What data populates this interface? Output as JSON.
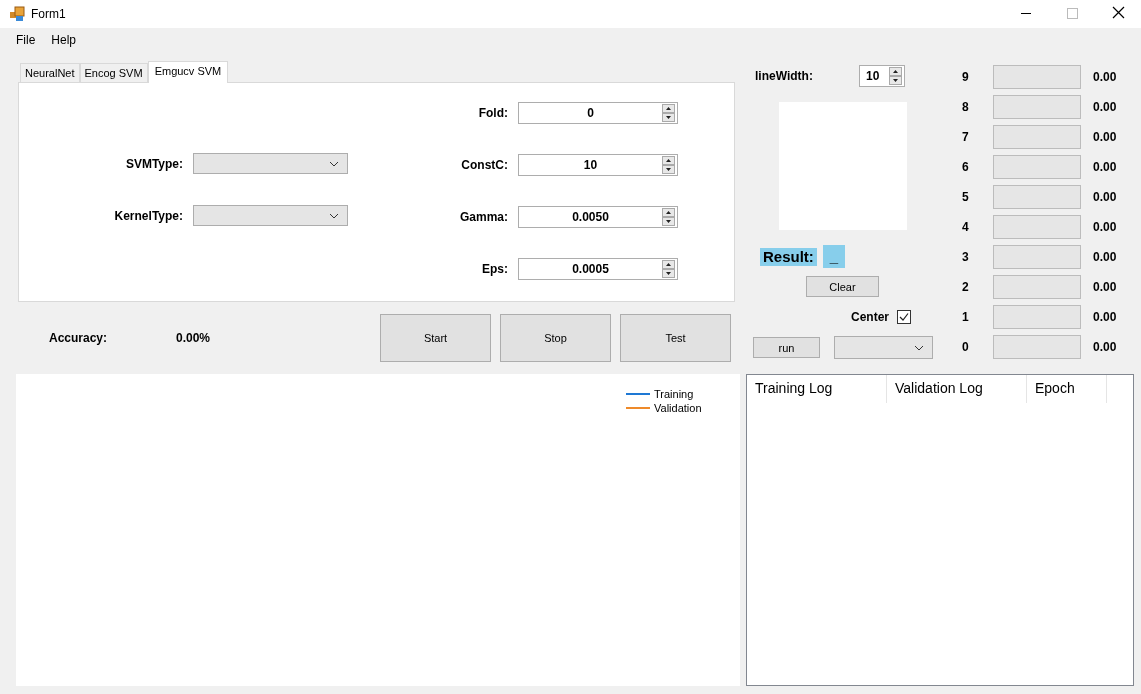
{
  "window": {
    "title": "Form1"
  },
  "menu": [
    "File",
    "Help"
  ],
  "tabs": [
    {
      "label": "NeuralNet",
      "selected": false
    },
    {
      "label": "Encog SVM",
      "selected": false
    },
    {
      "label": "Emgucv SVM",
      "selected": true
    }
  ],
  "svm_panel": {
    "selects": [
      {
        "label": "SVMType:"
      },
      {
        "label": "KernelType:"
      }
    ],
    "spinners": [
      {
        "label": "Fold:",
        "value": "0"
      },
      {
        "label": "ConstC:",
        "value": "10"
      },
      {
        "label": "Gamma:",
        "value": "0.0050"
      },
      {
        "label": "Eps:",
        "value": "0.0005"
      }
    ]
  },
  "accuracy": {
    "label": "Accuracy:",
    "value": "0.00%"
  },
  "buttons": [
    "Start",
    "Stop",
    "Test"
  ],
  "line_width": {
    "label": "lineWidth:",
    "value": "10"
  },
  "result": {
    "label": "Result:",
    "value": "_"
  },
  "clear_button": "Clear",
  "center": {
    "label": "Center",
    "checked": true
  },
  "run_button": "run",
  "digits": [
    {
      "label": "9",
      "level": 0,
      "reading": "0.00"
    },
    {
      "label": "8",
      "level": 0,
      "reading": "0.00"
    },
    {
      "label": "7",
      "level": 0,
      "reading": "0.00"
    },
    {
      "label": "6",
      "level": 0,
      "reading": "0.00"
    },
    {
      "label": "5",
      "level": 0,
      "reading": "0.00"
    },
    {
      "label": "4",
      "level": 0,
      "reading": "0.00"
    },
    {
      "label": "3",
      "level": 0,
      "reading": "0.00"
    },
    {
      "label": "2",
      "level": 0,
      "reading": "0.00"
    },
    {
      "label": "1",
      "level": 0,
      "reading": "0.00"
    },
    {
      "label": "0",
      "level": 0,
      "reading": "0.00"
    }
  ],
  "chart_legend": [
    {
      "name": "Training",
      "color": "#1e78d4"
    },
    {
      "name": "Validation",
      "color": "#ee8a2a"
    }
  ],
  "log_table": {
    "columns": [
      "Training Log",
      "Validation Log",
      "Epoch"
    ]
  }
}
